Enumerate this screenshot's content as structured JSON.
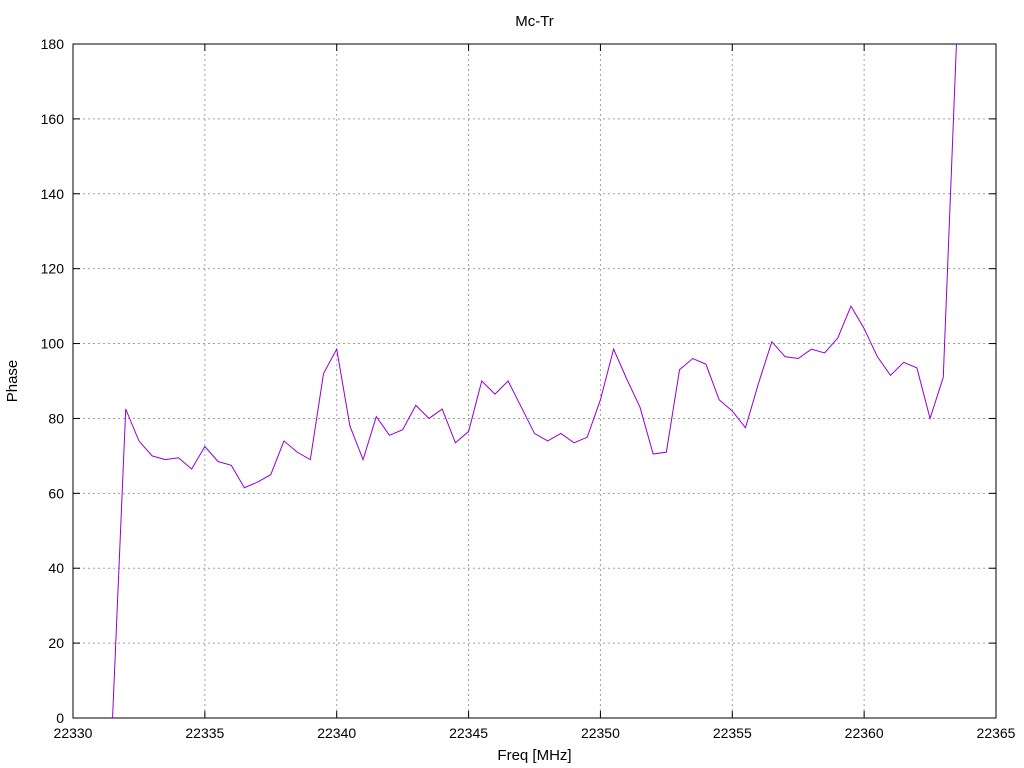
{
  "chart_data": {
    "type": "line",
    "title": "Mc-Tr",
    "xlabel": "Freq [MHz]",
    "ylabel": "Phase",
    "xlim": [
      22330,
      22365
    ],
    "ylim": [
      0,
      180
    ],
    "xticks": [
      22330,
      22335,
      22340,
      22345,
      22350,
      22355,
      22360,
      22365
    ],
    "yticks": [
      0,
      20,
      40,
      60,
      80,
      100,
      120,
      140,
      160,
      180
    ],
    "grid": true,
    "line_color": "#9400d3",
    "series": [
      {
        "x": [
          22331.5,
          22332.0,
          22332.5,
          22333.0,
          22333.5,
          22334.0,
          22334.5,
          22335.0,
          22335.5,
          22336.0,
          22336.5,
          22337.0,
          22337.5,
          22338.0,
          22338.5,
          22339.0,
          22339.5,
          22340.0,
          22340.5,
          22341.0,
          22341.5,
          22342.0,
          22342.5,
          22343.0,
          22343.5,
          22344.0,
          22344.5,
          22345.0,
          22345.5,
          22346.0,
          22346.5,
          22347.0,
          22347.5,
          22348.0,
          22348.5,
          22349.0,
          22349.5,
          22350.0,
          22350.5,
          22351.0,
          22351.5,
          22352.0,
          22352.5,
          22353.0,
          22353.5,
          22354.0,
          22354.5,
          22355.0,
          22355.5,
          22356.0,
          22356.5,
          22357.0,
          22357.5,
          22358.0,
          22358.5,
          22359.0,
          22359.5,
          22360.0,
          22360.5,
          22361.0,
          22361.5,
          22362.0,
          22362.5,
          22363.0,
          22363.5
        ],
        "values": [
          0,
          82.5,
          74,
          70,
          69,
          69.5,
          66.5,
          72.5,
          68.5,
          67.5,
          61.5,
          63,
          65,
          74,
          71,
          69,
          92,
          98.5,
          78,
          69,
          80.5,
          75.5,
          77,
          83.5,
          80,
          82.5,
          73.5,
          76.5,
          90,
          86.5,
          90,
          83,
          76,
          74,
          76,
          73.5,
          75,
          85,
          98.5,
          90.5,
          83,
          70.5,
          71,
          93,
          96,
          94.5,
          85,
          82,
          77.5,
          89.5,
          100.5,
          96.5,
          96,
          98.5,
          97.5,
          101.5,
          110,
          104,
          96.5,
          91.5,
          95,
          93.5,
          80,
          91,
          180
        ]
      }
    ]
  }
}
